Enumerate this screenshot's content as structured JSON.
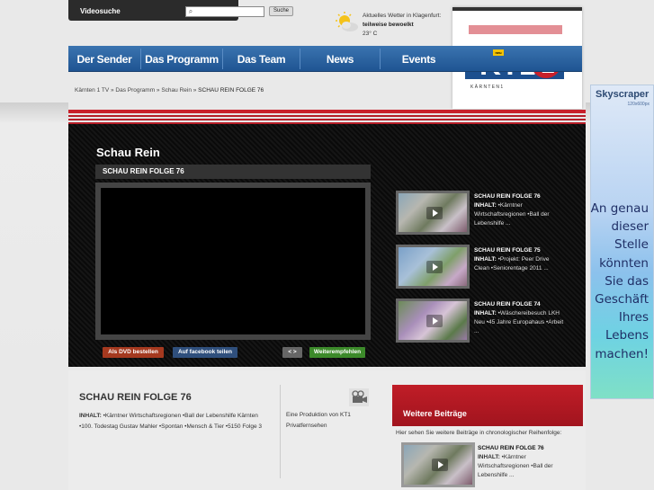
{
  "search": {
    "label": "Videosuche",
    "placeholder": "",
    "button": "Suche"
  },
  "weather": {
    "line1": "Aktuelles Wetter in Klagenfurt:",
    "condition": "teilweise bewoelkt",
    "temperature": "23° C"
  },
  "logo": {
    "brand": "KT1",
    "sub": "K Ä R N T E N 1"
  },
  "nav": {
    "items": [
      "Der Sender",
      "Das Programm",
      "Das Team",
      "News",
      "Events"
    ],
    "badge": "neu"
  },
  "breadcrumb": {
    "path": "Kärnten 1 TV » Das Programm » Schau Rein » ",
    "current": "SCHAU REIN FOLGE 76"
  },
  "player": {
    "section_title": "Schau Rein",
    "video_title": "SCHAU REIN FOLGE 76",
    "buttons": {
      "dvd": "Als DVD bestellen",
      "facebook": "Auf facebook teilen",
      "embed": "< >",
      "recommend": "Weiterempfehlen"
    }
  },
  "related": [
    {
      "title": "SCHAU REIN FOLGE 76",
      "label": "INHALT:",
      "text": "•Kärntner Wirtschaftsregionen •Ball der Lebenshilfe ..."
    },
    {
      "title": "SCHAU REIN FOLGE 75",
      "label": "INHALT:",
      "text": "•Projekt: Peer Drive Clean •Seniorentage 2011 ..."
    },
    {
      "title": "SCHAU REIN FOLGE 74",
      "label": "INHALT:",
      "text": "•Wäschereibesuch LKH Neu •45 Jahre Europahaus •Arbeit ..."
    }
  ],
  "lower": {
    "title": "SCHAU REIN FOLGE 76",
    "label": "INHALT:",
    "description": "•Kärntner Wirtschaftsregionen •Ball der Lebenshilfe Kärnten •100. Todestag Gustav Mahler •Spontan •Mensch & Tier •5150 Folge 3",
    "producer_line1": "Eine Produktion von KT1",
    "producer_line2": "Privatfernsehen"
  },
  "weitere": {
    "title": "Weitere Beiträge",
    "sub": "Hier sehen Sie weitere Beiträge in chronologischer Reihenfolge:",
    "item": {
      "title": "SCHAU REIN FOLGE 76",
      "label": "INHALT:",
      "text": "•Kärntner Wirtschaftsregionen •Ball der Lebenshilfe ..."
    }
  },
  "skyscraper": {
    "title": "Skyscraper",
    "size": "120x600px",
    "text": "An genau dieser Stelle könnten Sie das Geschäft Ihres Lebens machen!"
  },
  "colors": {
    "nav": "#2a62a3",
    "accent_red": "#c8202b",
    "dvd_button": "#a5391f",
    "fb_button": "#2f4f7c",
    "recommend_button": "#3c8a2a"
  }
}
